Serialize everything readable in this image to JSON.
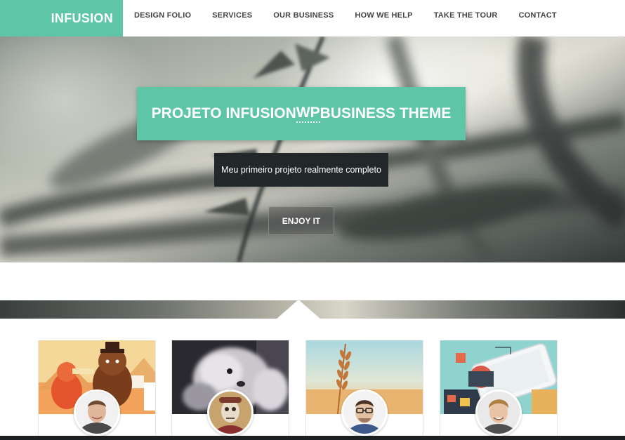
{
  "brand": {
    "logo_text": "INFUSION",
    "accent": "#5fc5a7"
  },
  "nav": {
    "items": [
      {
        "label": "DESIGN FOLIO"
      },
      {
        "label": "SERVICES"
      },
      {
        "label": "OUR BUSINESS"
      },
      {
        "label": "HOW WE HELP"
      },
      {
        "label": "TAKE THE TOUR"
      },
      {
        "label": "CONTACT"
      }
    ]
  },
  "hero": {
    "title_pre": "PROJETO INFUSION ",
    "title_wp": "WP",
    "title_post": " BUSINESS THEME",
    "subtitle": "Meu primeiro projeto realmente completo",
    "button_label": "ENJOY IT"
  },
  "team": {
    "cards": [
      {
        "image": "cartoon-bear-illustration",
        "avatar": "man-smiling-portrait"
      },
      {
        "image": "white-wolf-photo",
        "avatar": "person-with-mask-portrait"
      },
      {
        "image": "wheat-field-photo",
        "avatar": "man-with-glasses-portrait"
      },
      {
        "image": "smartphone-infographic-illustration",
        "avatar": "young-man-portrait"
      }
    ]
  }
}
